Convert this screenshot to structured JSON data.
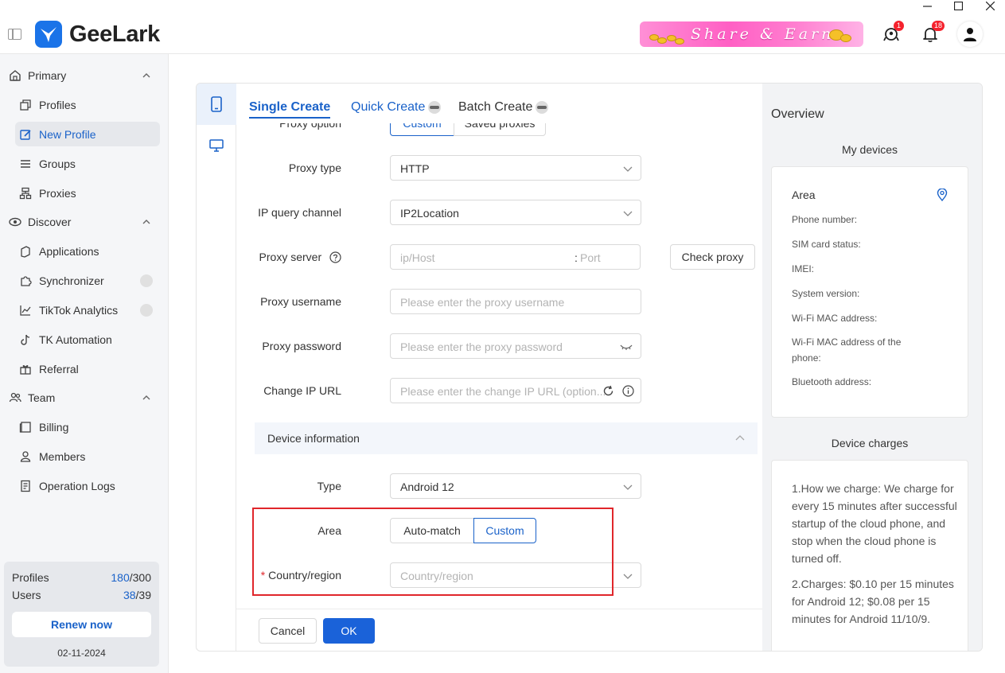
{
  "app": {
    "name": "GeeLark",
    "banner_text": "Share & Earn",
    "notifications": {
      "rocket_badge": "1",
      "bell_badge": "18"
    }
  },
  "sidebar": {
    "groups": [
      {
        "label": "Primary",
        "items": [
          "Profiles",
          "New Profile",
          "Groups",
          "Proxies"
        ]
      },
      {
        "label": "Discover",
        "items": [
          "Applications",
          "Synchronizer",
          "TikTok Analytics",
          "TK Automation",
          "Referral"
        ]
      },
      {
        "label": "Team",
        "items": [
          "Billing",
          "Members",
          "Operation Logs"
        ]
      }
    ],
    "active_item": "New Profile",
    "quota": {
      "profiles_label": "Profiles",
      "profiles_used": "180",
      "profiles_total": "/300",
      "users_label": "Users",
      "users_used": "38",
      "users_total": "/39",
      "renew_label": "Renew now",
      "date": "02-11-2024"
    }
  },
  "tabs": [
    {
      "label": "Single Create",
      "active": true
    },
    {
      "label": "Quick Create",
      "active": false
    },
    {
      "label": "Batch Create",
      "active": false
    }
  ],
  "form": {
    "proxy_option": {
      "label": "Proxy option",
      "options": [
        "Custom",
        "Saved proxies"
      ],
      "selected": "Custom"
    },
    "proxy_type": {
      "label": "Proxy type",
      "value": "HTTP"
    },
    "ip_query_channel": {
      "label": "IP query channel",
      "value": "IP2Location"
    },
    "proxy_server": {
      "label": "Proxy server",
      "host_placeholder": "ip/Host",
      "port_placeholder": "Port",
      "separator": ":"
    },
    "check_proxy_label": "Check proxy",
    "proxy_username": {
      "label": "Proxy username",
      "placeholder": "Please enter the proxy username"
    },
    "proxy_password": {
      "label": "Proxy password",
      "placeholder": "Please enter the proxy password"
    },
    "change_ip_url": {
      "label": "Change IP URL",
      "placeholder": "Please enter the change IP URL (option..."
    },
    "device_section": "Device information",
    "type": {
      "label": "Type",
      "value": "Android 12"
    },
    "area": {
      "label": "Area",
      "options": [
        "Auto-match",
        "Custom"
      ],
      "selected": "Custom"
    },
    "country": {
      "label": "Country/region",
      "required_mark": "*",
      "placeholder": "Country/region"
    }
  },
  "footer": {
    "cancel_label": "Cancel",
    "ok_label": "OK"
  },
  "overview": {
    "title": "Overview",
    "my_devices": "My devices",
    "fields": [
      "Area",
      "Phone number:",
      "SIM card status:",
      "IMEI:",
      "System version:",
      "Wi-Fi MAC address:",
      "Wi-Fi MAC address of the phone:",
      "Bluetooth address:"
    ],
    "charges_title": "Device charges",
    "charges": [
      "1.How we charge: We charge for every 15 minutes after successful startup of the cloud phone, and stop when the cloud phone is turned off.",
      "2.Charges: $0.10 per 15 minutes for Android 12; $0.08 per 15 minutes for Android 11/10/9."
    ]
  },
  "colors": {
    "accent": "#1a62c9",
    "highlight_border": "#e0262b",
    "ok_button": "#1a62d9"
  }
}
